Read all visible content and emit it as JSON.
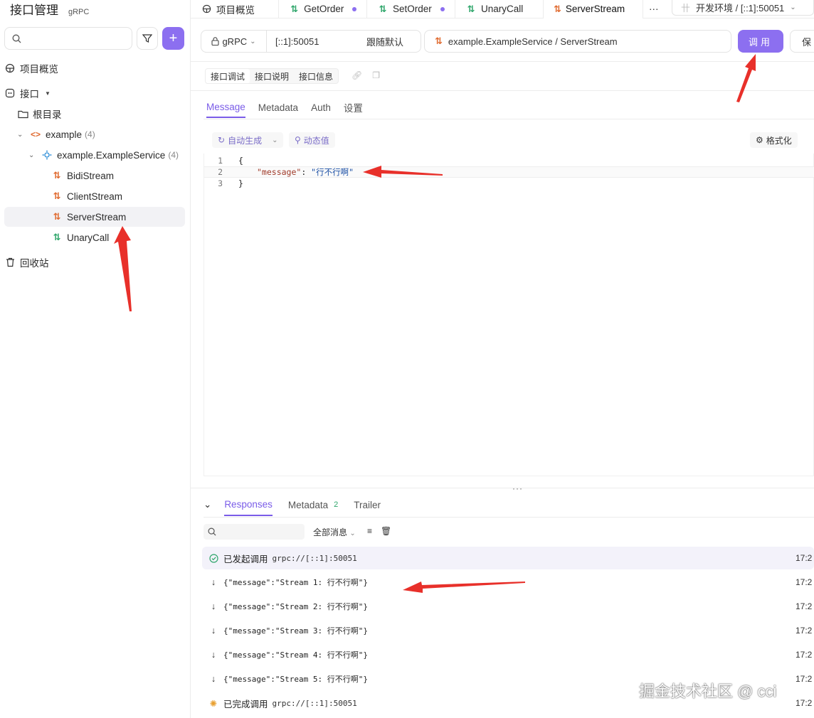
{
  "sidebar": {
    "title": "接口管理",
    "subtitle": "gRPC",
    "search_placeholder": "",
    "add_label": "+",
    "overview_label": "项目概览",
    "interfaces_label": "接口",
    "root_label": "根目录",
    "package_label": "example",
    "package_count": "(4)",
    "service_label": "example.ExampleService",
    "service_count": "(4)",
    "methods": [
      "BidiStream",
      "ClientStream",
      "ServerStream",
      "UnaryCall"
    ],
    "recycle_label": "回收站"
  },
  "tabs": {
    "items": [
      "项目概览",
      "GetOrder",
      "SetOrder",
      "UnaryCall",
      "ServerStream"
    ],
    "more": "···",
    "env_label": "开发环境 / [::1]:50051"
  },
  "request": {
    "protocol": "gRPC",
    "host": "[::1]:50051",
    "follow": "跟随默认",
    "method_path": "example.ExampleService / ServerStream",
    "call_label": "调用",
    "save_label": "保"
  },
  "subtabs": [
    "接口调试",
    "接口说明",
    "接口信息"
  ],
  "message_tabs": [
    "Message",
    "Metadata",
    "Auth",
    "设置"
  ],
  "editor_tools": {
    "auto_generate": "自动生成",
    "dynamic_value": "动态值",
    "format": "格式化"
  },
  "code": {
    "line1": "{",
    "key": "\"message\"",
    "colon": ": ",
    "value": "\"行不行啊\"",
    "line3": "}",
    "numbers": [
      "1",
      "2",
      "3"
    ]
  },
  "drag_handle": "···",
  "responses": {
    "tabs": [
      "Responses",
      "Metadata",
      "Trailer"
    ],
    "metadata_badge": "2",
    "filter_label": "全部消息",
    "rows": [
      {
        "text": "已发起调用",
        "url": "grpc://[::1]:50051",
        "time": "17:2"
      },
      {
        "payload": "{\"message\":\"Stream 1: 行不行啊\"}",
        "time": "17:2"
      },
      {
        "payload": "{\"message\":\"Stream 2: 行不行啊\"}",
        "time": "17:2"
      },
      {
        "payload": "{\"message\":\"Stream 3: 行不行啊\"}",
        "time": "17:2"
      },
      {
        "payload": "{\"message\":\"Stream 4: 行不行啊\"}",
        "time": "17:2"
      },
      {
        "payload": "{\"message\":\"Stream 5: 行不行啊\"}",
        "time": "17:2"
      },
      {
        "text": "已完成调用",
        "url": "grpc://[::1]:50051",
        "time": "17:2"
      }
    ]
  },
  "watermark": "掘金技术社区 @ cci",
  "colors": {
    "accent": "#8c6ff0",
    "stream_icon": "#e06a2f",
    "unary_icon": "#2fa66b",
    "annotation_arrow": "#e8302a"
  }
}
